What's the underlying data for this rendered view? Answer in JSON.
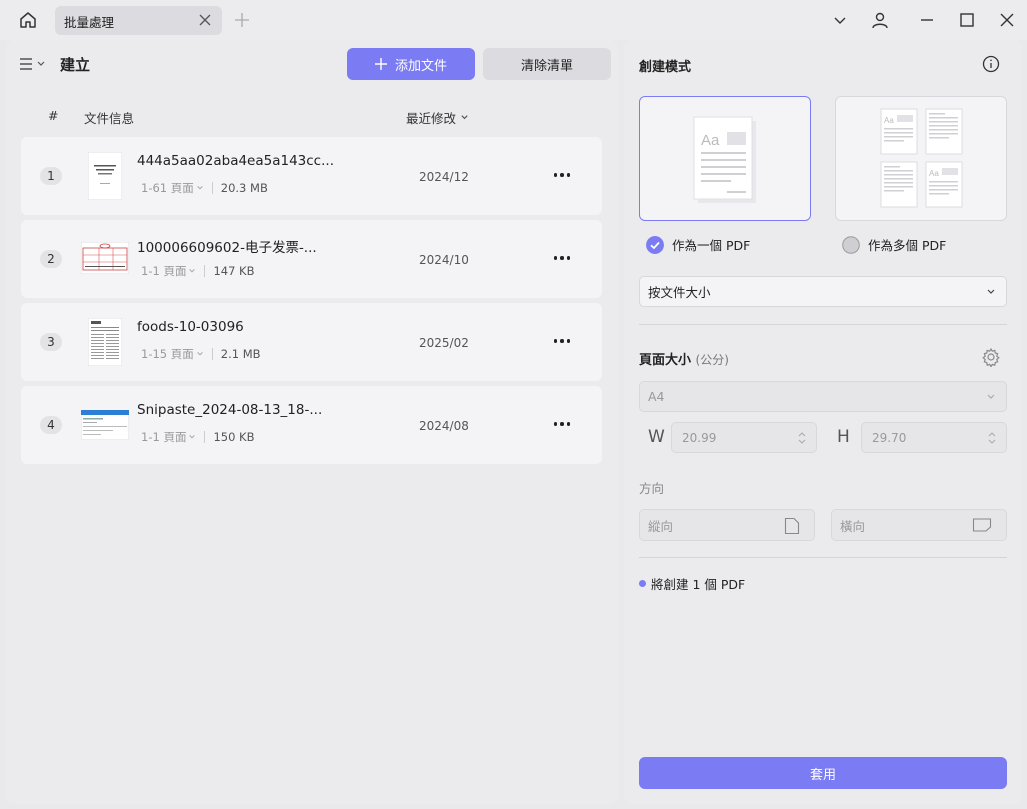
{
  "tabbar": {
    "tab_label": "批量處理"
  },
  "toolbar": {
    "title": "建立",
    "add_label": "添加文件",
    "clear_label": "清除清單"
  },
  "table": {
    "headers": {
      "num": "#",
      "info": "文件信息",
      "modified": "最近修改"
    },
    "rows": [
      {
        "num": "1",
        "name": "444a5aa02aba4ea5a143cc...",
        "pages": "1-61 頁面",
        "size": "20.3 MB",
        "date": "2024/12"
      },
      {
        "num": "2",
        "name": "100006609602-电子发票-...",
        "pages": "1-1 頁面",
        "size": "147 KB",
        "date": "2024/10"
      },
      {
        "num": "3",
        "name": "foods-10-03096",
        "pages": "1-15 頁面",
        "size": "2.1 MB",
        "date": "2025/02"
      },
      {
        "num": "4",
        "name": "Snipaste_2024-08-13_18-...",
        "pages": "1-1 頁面",
        "size": "150 KB",
        "date": "2024/08"
      }
    ]
  },
  "create_mode": {
    "title": "創建模式",
    "option_single": "作為一個 PDF",
    "option_multi": "作為多個 PDF",
    "selected": "single",
    "sort_select": "按文件大小"
  },
  "page_size": {
    "title": "頁面大小",
    "unit": "(公分)",
    "preset": "A4",
    "width_label": "W",
    "width_value": "20.99",
    "height_label": "H",
    "height_value": "29.70"
  },
  "orientation": {
    "title": "方向",
    "portrait": "縱向",
    "landscape": "橫向"
  },
  "summary": "將創建 1 個 PDF",
  "apply_label": "套用",
  "colors": {
    "accent": "#7b7bf4",
    "panel": "#ebebee",
    "row": "#f4f4f6"
  }
}
